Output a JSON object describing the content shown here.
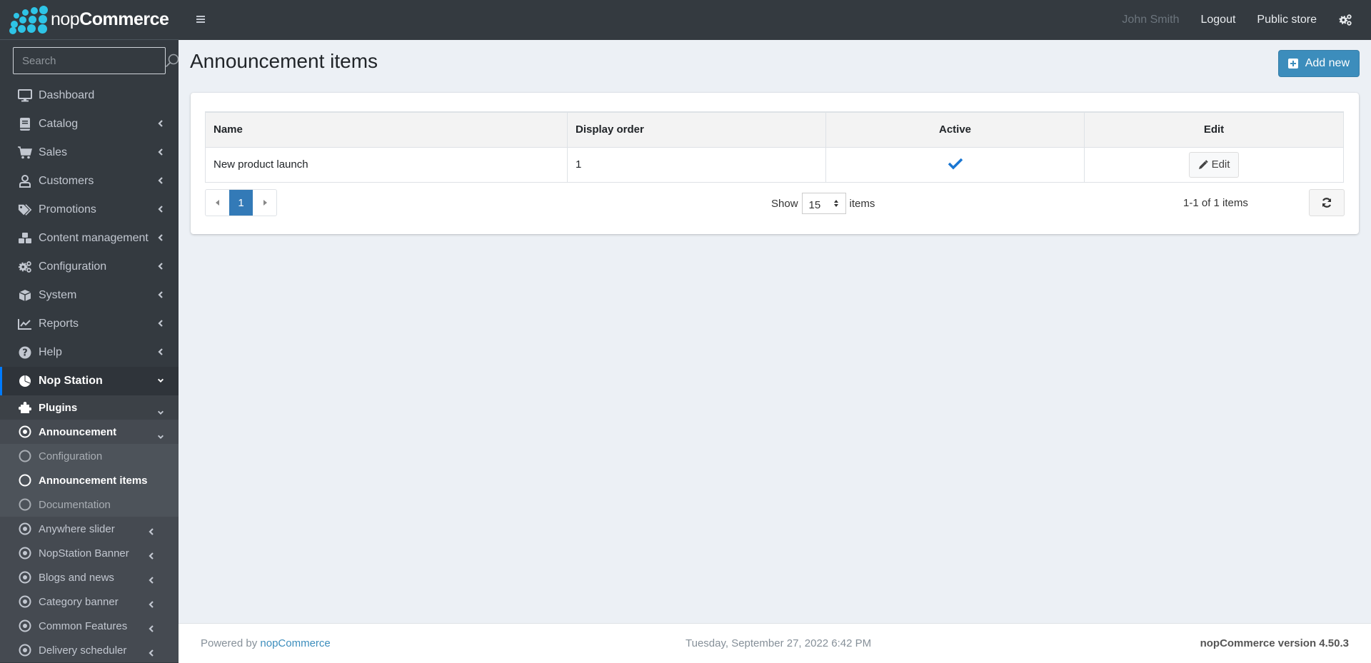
{
  "brand": {
    "prefix": "nop",
    "name": "Commerce"
  },
  "search": {
    "placeholder": "Search"
  },
  "sidebar": {
    "items": [
      {
        "label": "Dashboard",
        "icon": "desktop-icon"
      },
      {
        "label": "Catalog",
        "icon": "book-icon"
      },
      {
        "label": "Sales",
        "icon": "cart-icon"
      },
      {
        "label": "Customers",
        "icon": "user-icon"
      },
      {
        "label": "Promotions",
        "icon": "tags-icon"
      },
      {
        "label": "Content management",
        "icon": "cubes-icon"
      },
      {
        "label": "Configuration",
        "icon": "gears-icon"
      },
      {
        "label": "System",
        "icon": "cube-icon"
      },
      {
        "label": "Reports",
        "icon": "chart-line-icon"
      },
      {
        "label": "Help",
        "icon": "question-circle-icon"
      },
      {
        "label": "Nop Station",
        "icon": "nopstation-icon"
      },
      {
        "label": "Plugins",
        "icon": "puzzle-icon"
      },
      {
        "label": "Announcement",
        "icon": "dot-circle-icon"
      },
      {
        "label": "Configuration",
        "icon": "circle-icon"
      },
      {
        "label": "Announcement items",
        "icon": "circle-icon"
      },
      {
        "label": "Documentation",
        "icon": "circle-icon"
      },
      {
        "label": "Anywhere slider",
        "icon": "dot-circle-icon"
      },
      {
        "label": "NopStation Banner",
        "icon": "dot-circle-icon"
      },
      {
        "label": "Blogs and news",
        "icon": "dot-circle-icon"
      },
      {
        "label": "Category banner",
        "icon": "dot-circle-icon"
      },
      {
        "label": "Common Features",
        "icon": "dot-circle-icon"
      },
      {
        "label": "Delivery scheduler",
        "icon": "dot-circle-icon"
      }
    ]
  },
  "header": {
    "user": "John Smith",
    "logout": "Logout",
    "public_store": "Public store"
  },
  "page": {
    "title": "Announcement items",
    "add_new": "Add new"
  },
  "table": {
    "columns": [
      "Name",
      "Display order",
      "Active",
      "Edit"
    ],
    "rows": [
      {
        "name": "New product launch",
        "display_order": "1",
        "active": true,
        "edit": "Edit"
      }
    ]
  },
  "pager": {
    "current_page": "1",
    "show_label": "Show",
    "page_size": "15",
    "items_label": "items",
    "summary": "1-1 of 1 items"
  },
  "footer": {
    "powered_by": "Powered by ",
    "powered_link": "nopCommerce",
    "datetime": "Tuesday, September 27, 2022 6:42 PM",
    "version": "nopCommerce version 4.50.3"
  },
  "colors": {
    "primary": "#3c8dbc",
    "pager_active": "#337ab7",
    "check": "#1976d2",
    "sidebar_bg": "#343a40",
    "active_indicator": "#007bff"
  }
}
